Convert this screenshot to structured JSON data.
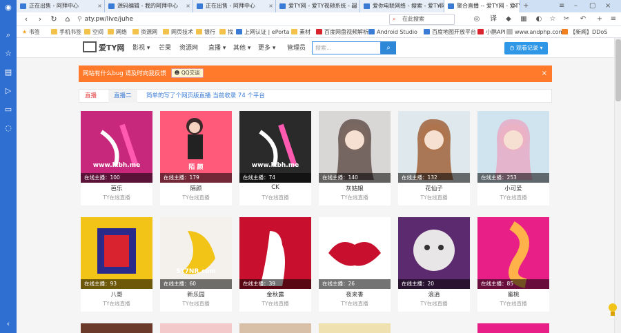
{
  "browser": {
    "tabs": [
      {
        "title": "正在出售 - 阿拜中心"
      },
      {
        "title": "源码编辑 - 我的阿拜中心"
      },
      {
        "title": "正在出售 - 阿拜中心"
      },
      {
        "title": "爱TY网 - 爱TY视频系统 - 超"
      },
      {
        "title": "爱你电联网络 - 搜索 - 爱TY网"
      },
      {
        "title": "聚合直播 -- 爱TY网 - 爱TY"
      }
    ],
    "address": "aty.pw/live/juhe",
    "search_placeholder": "在此搜索",
    "bookmarks": [
      "书签",
      "手机书签",
      "空间",
      "网络",
      "资源网",
      "网页技术",
      "银行",
      "找",
      "上网认证 | ePorta",
      "素材",
      "百度网盘视频解析",
      "Android Studio",
      "百度地图开放平台",
      "小鹏API",
      "www.andphp.com",
      "【新闻】DDoS"
    ]
  },
  "site": {
    "logo": "爱TY网",
    "menu": [
      "影视",
      "芒果",
      "资源网",
      "直播",
      "其他",
      "更多",
      "管理员"
    ],
    "search_placeholder": "搜索...",
    "history_button": "观看记录",
    "notice": "网站有什么bug 请及时向我反馈",
    "qq_button": "QQ交谈",
    "page_tabs": [
      "直播",
      "直播二"
    ],
    "tab_info": "简单的写了个网页版直播 当前收录 74 个平台"
  },
  "cards": [
    {
      "name": "芭乐",
      "online": "在线主播：100",
      "sub": "TY在线直播",
      "watermark": "www.lxbh.me",
      "color": "#c8287c"
    },
    {
      "name": "陌颜",
      "online": "在线主播：179",
      "sub": "TY在线直播",
      "watermark": "陌 颜",
      "color": "#ff5a7a"
    },
    {
      "name": "CK",
      "online": "在线主播：74",
      "sub": "TY在线直播",
      "watermark": "www.lxbh.me",
      "color": "#2a2a2a"
    },
    {
      "name": "灰姑娘",
      "online": "在线主播：140",
      "sub": "TY在线直播",
      "watermark": "",
      "color": "#d9d7d5"
    },
    {
      "name": "花仙子",
      "online": "在线主播：132",
      "sub": "TY在线直播",
      "watermark": "",
      "color": "#dfe8ec"
    },
    {
      "name": "小可爱",
      "online": "在线主播：253",
      "sub": "TY在线直播",
      "watermark": "",
      "color": "#cfe4ef"
    },
    {
      "name": "八哥",
      "online": "在线主播：93",
      "sub": "TY在线直播",
      "watermark": "",
      "color": "#f2c418"
    },
    {
      "name": "新乐园",
      "online": "在线主播：60",
      "sub": "TY在线直播",
      "watermark": "517NR.com",
      "color": "#f4f1ec"
    },
    {
      "name": "金秋露",
      "online": "在线主播：39",
      "sub": "TY在线直播",
      "watermark": "",
      "color": "#c8102e"
    },
    {
      "name": "夜来香",
      "online": "在线主播：26",
      "sub": "TY在线直播",
      "watermark": "",
      "color": "#ffffff"
    },
    {
      "name": "浪逍",
      "online": "在线主播：20",
      "sub": "TY在线直播",
      "watermark": "",
      "color": "#5c2a6e"
    },
    {
      "name": "蜜桃",
      "online": "在线主播：85",
      "sub": "TY在线直播",
      "watermark": "",
      "color": "#e81f86"
    }
  ]
}
